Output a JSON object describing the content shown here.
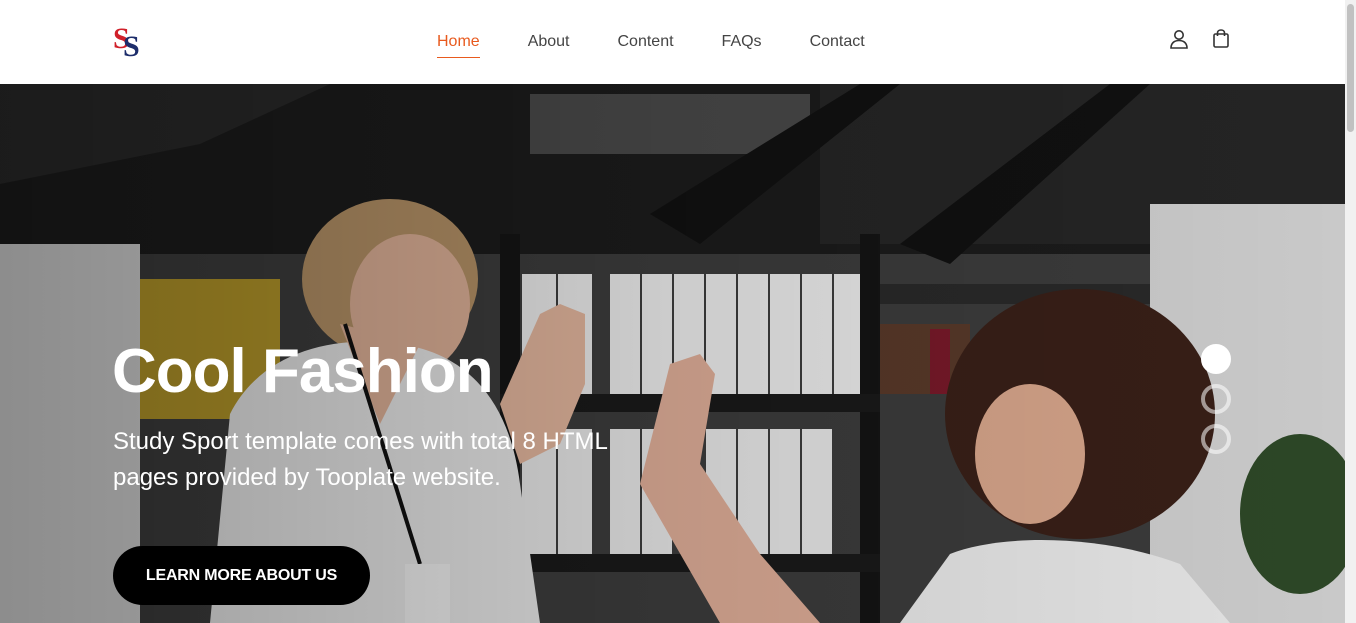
{
  "header": {
    "logo": {
      "icon": "ss-monogram-logo",
      "colors": [
        "#d0202a",
        "#1d2d6b"
      ]
    },
    "nav": [
      {
        "label": "Home",
        "active": true
      },
      {
        "label": "About",
        "active": false
      },
      {
        "label": "Content",
        "active": false
      },
      {
        "label": "FAQs",
        "active": false
      },
      {
        "label": "Contact",
        "active": false
      }
    ],
    "icons": [
      "user-icon",
      "shopping-bag-icon"
    ],
    "accent": "#e85a1e"
  },
  "hero": {
    "title": "Cool Fashion",
    "subtitle": "Study Sport template comes with total 8 HTML pages provided by Tooplate website.",
    "button_label": "LEARN MORE ABOUT US",
    "slides": {
      "count": 3,
      "active_index": 0
    }
  }
}
